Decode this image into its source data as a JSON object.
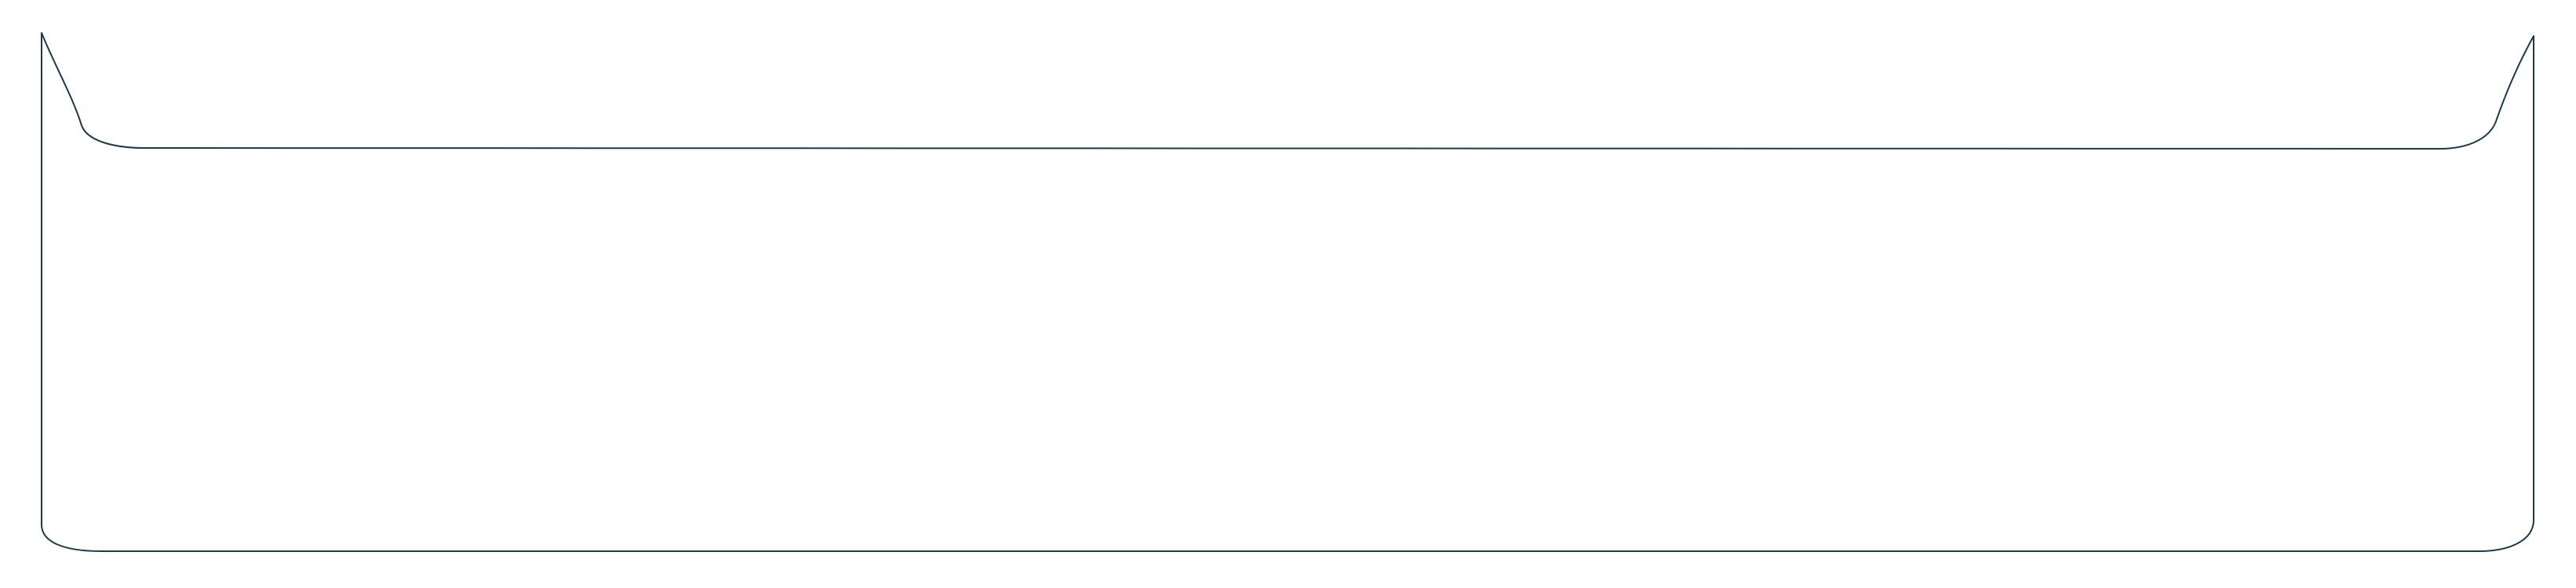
{
  "outline": {
    "stroke_color": "#1b3a4b",
    "fill_color": "#ffffff"
  }
}
